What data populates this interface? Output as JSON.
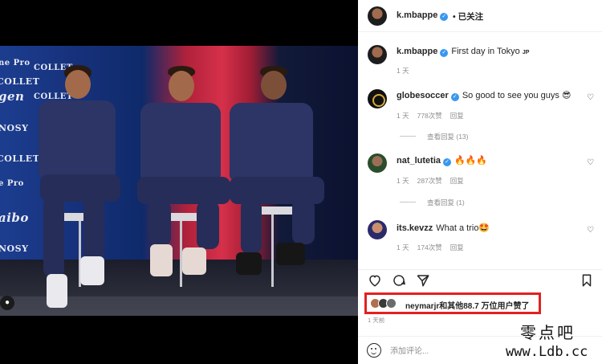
{
  "post": {
    "author": "k.mbappe",
    "follow_status": "已关注",
    "more_label": "•••"
  },
  "media": {
    "sponsors": [
      "ne Pro",
      "COLLET",
      "gen",
      "NOSY",
      "COLLET",
      "e Pro",
      "aibo",
      "NOSY"
    ],
    "sponsor_marks": [
      "COLLET",
      "COLLET"
    ]
  },
  "caption": {
    "user": "k.mbappe",
    "text": "First day in Tokyo",
    "flag": "JP",
    "time": "1 天"
  },
  "comments": [
    {
      "user": "globesoccer",
      "verified": true,
      "text": "So good to see you guys 😎",
      "time": "1 天",
      "likes": "778次赞",
      "reply": "回复",
      "view_replies": "查看回复 (13)"
    },
    {
      "user": "nat_lutetia",
      "verified": true,
      "text": "🔥🔥🔥",
      "time": "1 天",
      "likes": "287次赞",
      "reply": "回复",
      "view_replies": "查看回复 (1)"
    },
    {
      "user": "its.kevzz",
      "verified": false,
      "text": "What a trio🤩",
      "time": "1 天",
      "likes": "174次赞",
      "reply": "回复"
    }
  ],
  "likes_summary": {
    "user": "neymarjr",
    "text": "和其他88.7 万位用户赞了"
  },
  "post_date": "1 天前",
  "comment_box": {
    "placeholder": "添加评论..."
  },
  "watermark": {
    "cn": "零点吧",
    "url": "www.Ldb.cc"
  },
  "colors": {
    "verified": "#3897f0",
    "highlight_box": "#e32020",
    "meta_text": "#8e8e8e"
  }
}
